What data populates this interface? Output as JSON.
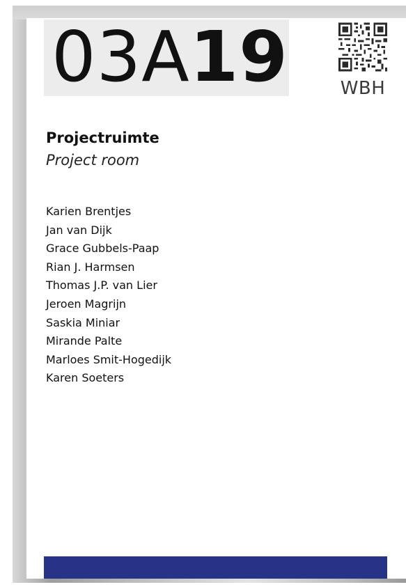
{
  "room": {
    "prefix": "03A",
    "suffix": "19",
    "building": "WBH"
  },
  "title": {
    "nl": "Projectruimte",
    "en": "Project room"
  },
  "occupants": [
    "Karien Brentjes",
    "Jan van Dijk",
    "Grace Gubbels-Paap",
    "Rian J. Harmsen",
    "Thomas J.P. van Lier",
    "Jeroen Magrijn",
    "Saskia Miniar",
    "Mirande Palte",
    "Marloes Smit-Hogedijk",
    "Karen Soeters"
  ],
  "colors": {
    "accent_bar": "#263387",
    "frame": "#b8b8b8",
    "number_box": "#ececec"
  },
  "icons": {
    "qr": "qr-code-icon"
  }
}
